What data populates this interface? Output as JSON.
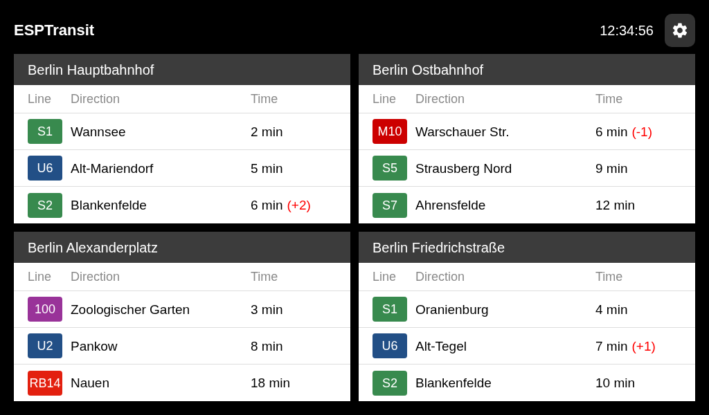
{
  "app": {
    "title": "ESPTransit",
    "clock": "12:34:56"
  },
  "stations": [
    {
      "name": "Berlin Hauptbahnhof",
      "columns": [
        "Line",
        "Direction",
        "Time"
      ],
      "departures": [
        {
          "line": "S1",
          "color": "#388a4e",
          "direction": "Wannsee",
          "time": "2 min"
        },
        {
          "line": "U6",
          "color": "#224f86",
          "direction": "Alt-Mariendorf",
          "time": "5 min"
        },
        {
          "line": "S2",
          "color": "#388a4e",
          "direction": "Blankenfelde",
          "time": "6 min",
          "delay": "(+2)"
        }
      ]
    },
    {
      "name": "Berlin Ostbahnhof",
      "columns": [
        "Line",
        "Direction",
        "Time"
      ],
      "departures": [
        {
          "line": "M10",
          "color": "#cc0000",
          "direction": "Warschauer Str.",
          "time": "6 min",
          "delay": "(-1)"
        },
        {
          "line": "S5",
          "color": "#388a4e",
          "direction": "Strausberg Nord",
          "time": "9 min"
        },
        {
          "line": "S7",
          "color": "#388a4e",
          "direction": "Ahrensfelde",
          "time": "12 min"
        }
      ]
    },
    {
      "name": "Berlin Alexanderplatz",
      "columns": [
        "Line",
        "Direction",
        "Time"
      ],
      "departures": [
        {
          "line": "100",
          "color": "#993399",
          "direction": "Zoologischer Garten",
          "time": "3 min"
        },
        {
          "line": "U2",
          "color": "#224f86",
          "direction": "Pankow",
          "time": "8 min"
        },
        {
          "line": "RB14",
          "color": "#e3200f",
          "direction": "Nauen",
          "time": "18 min"
        }
      ]
    },
    {
      "name": "Berlin Friedrichstraße",
      "columns": [
        "Line",
        "Direction",
        "Time"
      ],
      "departures": [
        {
          "line": "S1",
          "color": "#388a4e",
          "direction": "Oranienburg",
          "time": "4 min"
        },
        {
          "line": "U6",
          "color": "#224f86",
          "direction": "Alt-Tegel",
          "time": "7 min",
          "delay": "(+1)"
        },
        {
          "line": "S2",
          "color": "#388a4e",
          "direction": "Blankenfelde",
          "time": "10 min"
        }
      ]
    }
  ]
}
